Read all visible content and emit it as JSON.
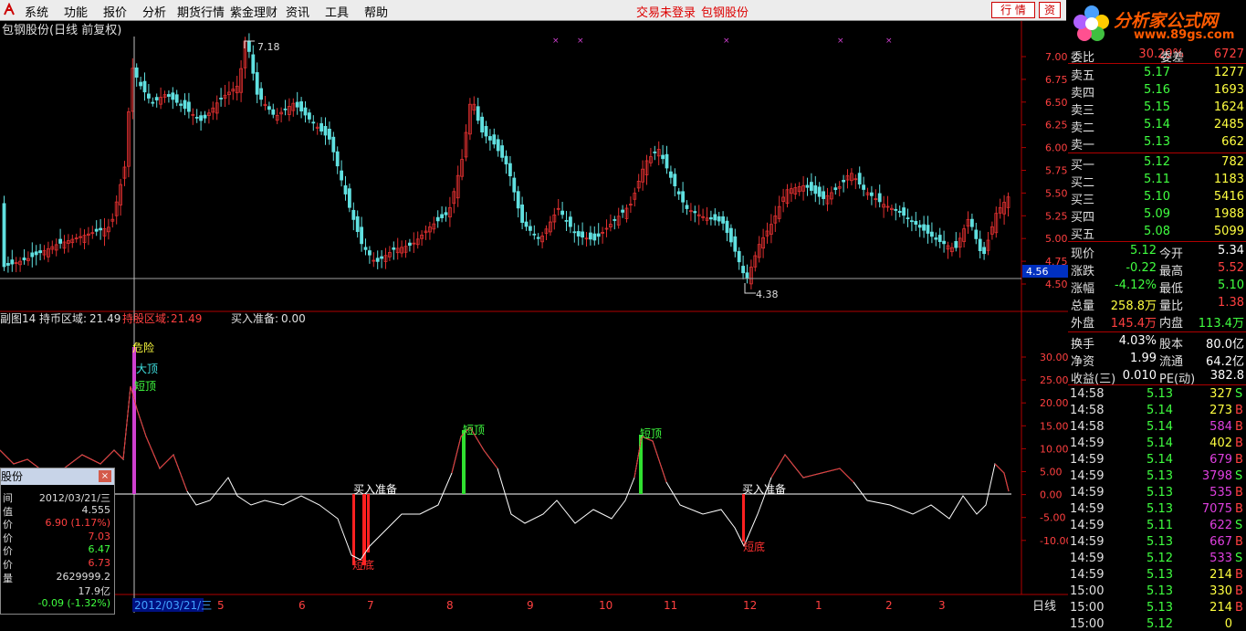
{
  "menu": {
    "items": [
      "系统",
      "功能",
      "报价",
      "分析",
      "期货行情",
      "紫金理财",
      "资讯",
      "工具",
      "帮助"
    ],
    "status": "交易未登录",
    "stock": "包钢股份",
    "tab_hq": "行 情",
    "tab_zi": "资"
  },
  "brand": {
    "name": "分析家公式网",
    "site": "www.89gs.com"
  },
  "chart": {
    "title": "包钢股份(日线 前复权)",
    "price_ticks": [
      "7.00",
      "6.75",
      "6.50",
      "6.25",
      "6.00",
      "5.75",
      "5.50",
      "5.25",
      "5.00",
      "4.75",
      "4.50"
    ],
    "current_price_label": "4.56",
    "high_label": "7.18",
    "low_label": "4.38",
    "indicator": {
      "name": "副图14",
      "items": [
        {
          "label": "持币区域:",
          "value": "21.49"
        },
        {
          "label": "持股区域:",
          "value": "21.49"
        },
        {
          "label": "买入准备:",
          "value": "0.00"
        }
      ]
    },
    "ind_ticks": [
      "30.00",
      "25.00",
      "20.00",
      "15.00",
      "10.00",
      "5.00",
      "0.00",
      "-5.00",
      "-10.00"
    ],
    "annotations": {
      "danger": "危险",
      "big_top": "大顶",
      "short_top": "短顶",
      "buy_prep": "买入准备",
      "short_bottom": "短底"
    },
    "x_labels": [
      "2012/03/21/三",
      "5",
      "6",
      "7",
      "8",
      "9",
      "10",
      "11",
      "12",
      "1",
      "2",
      "3"
    ],
    "period": "日线",
    "colors": {
      "up": "#e03030",
      "down": "#60e0e0",
      "panel_border": "#b00000",
      "indicator_line": "#ffffff"
    }
  },
  "quote": {
    "wei": {
      "label1": "委比",
      "value1": "30.29%",
      "label2": "委差",
      "value2": "6727"
    },
    "asks": [
      {
        "label": "卖五",
        "price": "5.17",
        "vol": "1277"
      },
      {
        "label": "卖四",
        "price": "5.16",
        "vol": "1693"
      },
      {
        "label": "卖三",
        "price": "5.15",
        "vol": "1624"
      },
      {
        "label": "卖二",
        "price": "5.14",
        "vol": "2485"
      },
      {
        "label": "卖一",
        "price": "5.13",
        "vol": "662"
      }
    ],
    "bids": [
      {
        "label": "买一",
        "price": "5.12",
        "vol": "782"
      },
      {
        "label": "买二",
        "price": "5.11",
        "vol": "1183"
      },
      {
        "label": "买三",
        "price": "5.10",
        "vol": "5416"
      },
      {
        "label": "买四",
        "price": "5.09",
        "vol": "1988"
      },
      {
        "label": "买五",
        "price": "5.08",
        "vol": "5099"
      }
    ],
    "stats": [
      {
        "l1": "现价",
        "v1": "5.12",
        "l2": "今开",
        "v2": "5.34"
      },
      {
        "l1": "涨跌",
        "v1": "-0.22",
        "l2": "最高",
        "v2": "5.52"
      },
      {
        "l1": "涨幅",
        "v1": "-4.12%",
        "l2": "最低",
        "v2": "5.10"
      },
      {
        "l1": "总量",
        "v1": "258.8万",
        "l2": "量比",
        "v2": "1.38"
      },
      {
        "l1": "外盘",
        "v1": "145.4万",
        "l2": "内盘",
        "v2": "113.4万"
      },
      {
        "l1": "换手",
        "v1": "4.03%",
        "l2": "股本",
        "v2": "80.0亿"
      },
      {
        "l1": "净资",
        "v1": "1.99",
        "l2": "流通",
        "v2": "64.2亿"
      },
      {
        "l1": "收益(三)",
        "v1": "0.010",
        "l2": "PE(动)",
        "v2": "382.8"
      }
    ],
    "ticks": [
      {
        "time": "14:58",
        "price": "5.13",
        "vol": "327",
        "side": "S"
      },
      {
        "time": "14:58",
        "price": "5.14",
        "vol": "273",
        "side": "B"
      },
      {
        "time": "14:58",
        "price": "5.14",
        "vol": "584",
        "side": "B"
      },
      {
        "time": "14:59",
        "price": "5.14",
        "vol": "402",
        "side": "B"
      },
      {
        "time": "14:59",
        "price": "5.14",
        "vol": "679",
        "side": "B"
      },
      {
        "time": "14:59",
        "price": "5.13",
        "vol": "3798",
        "side": "S"
      },
      {
        "time": "14:59",
        "price": "5.13",
        "vol": "535",
        "side": "B"
      },
      {
        "time": "14:59",
        "price": "5.13",
        "vol": "7075",
        "side": "B"
      },
      {
        "time": "14:59",
        "price": "5.11",
        "vol": "622",
        "side": "S"
      },
      {
        "time": "14:59",
        "price": "5.13",
        "vol": "667",
        "side": "B"
      },
      {
        "time": "14:59",
        "price": "5.12",
        "vol": "533",
        "side": "S"
      },
      {
        "time": "14:59",
        "price": "5.13",
        "vol": "214",
        "side": "B"
      },
      {
        "time": "15:00",
        "price": "5.13",
        "vol": "330",
        "side": "B"
      },
      {
        "time": "15:00",
        "price": "5.13",
        "vol": "214",
        "side": "B"
      },
      {
        "time": "15:00",
        "price": "5.12",
        "vol": "0",
        "side": ""
      }
    ]
  },
  "popup": {
    "title": "股份",
    "close": "×",
    "rows": [
      {
        "k": "间",
        "v": "2012/03/21/三",
        "c": "#dddddd"
      },
      {
        "k": "值",
        "v": "4.555",
        "c": "#dddddd"
      },
      {
        "k": "价",
        "v": "6.90 (1.17%)",
        "c": "#ff4040"
      },
      {
        "k": "价",
        "v": "7.03",
        "c": "#ff4040"
      },
      {
        "k": "价",
        "v": "6.47",
        "c": "#40ff40"
      },
      {
        "k": "价",
        "v": "6.73",
        "c": "#ff4040"
      },
      {
        "k": "量",
        "v": "2629999.2",
        "c": "#dddddd"
      },
      {
        "k": "",
        "v": "17.9亿",
        "c": "#dddddd"
      },
      {
        "k": "",
        "v": "-0.09 (-1.32%)",
        "c": "#40ff40"
      }
    ]
  }
}
